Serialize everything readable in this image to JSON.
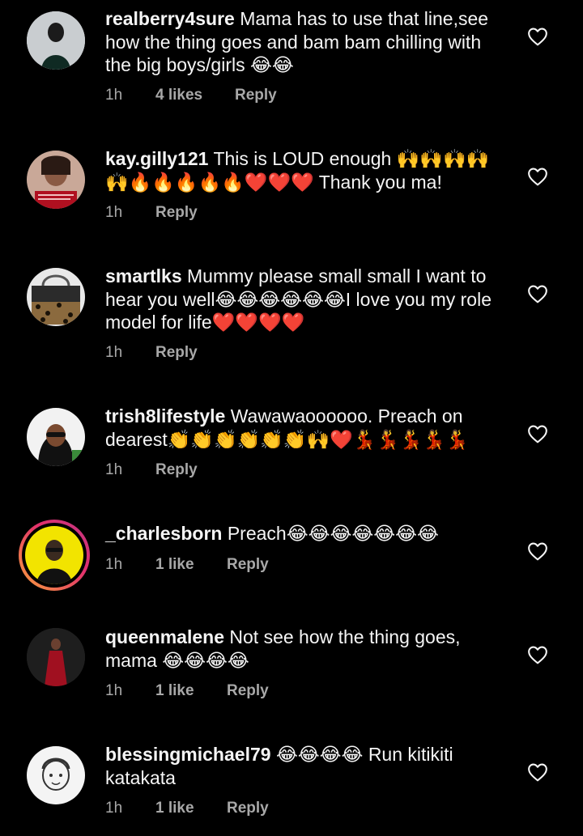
{
  "comments": [
    {
      "username": "realberry4sure",
      "text": "Mama has to use that line,see how the thing goes and bam bam chilling with the big boys/girls 😂😂",
      "time": "1h",
      "likes": "4 likes",
      "reply": "Reply"
    },
    {
      "username": "kay.gilly121",
      "text": "This is LOUD enough 🙌🙌🙌🙌🙌🔥🔥🔥🔥🔥❤️❤️❤️ Thank you ma!",
      "time": "1h",
      "reply": "Reply"
    },
    {
      "username": "smartlks",
      "text": "Mummy please small small I want to hear you well😂😂😂😂😂😂I love you my role model for life❤️❤️❤️❤️",
      "time": "1h",
      "reply": "Reply"
    },
    {
      "username": "trish8lifestyle",
      "text": "Wawawaoooooo. Preach on dearest👏👏👏👏👏👏🙌❤️💃💃💃💃💃",
      "time": "1h",
      "reply": "Reply"
    },
    {
      "username": "_charlesborn",
      "text": "Preach😂😂😂😂😂😂😂",
      "time": "1h",
      "likes": "1 like",
      "reply": "Reply"
    },
    {
      "username": "queenmalene",
      "text": "Not see how the thing goes, mama 😂😂😂😂",
      "time": "1h",
      "likes": "1 like",
      "reply": "Reply"
    },
    {
      "username": "blessingmichael79",
      "text": "😂😂😂😂 Run kitikiti katakata",
      "time": "1h",
      "likes": "1 like",
      "reply": "Reply"
    }
  ],
  "icons": {
    "like": "heart-outline-icon"
  },
  "colors": {
    "background": "#000000",
    "text": "#f5f5f5",
    "meta": "#a8a8a8",
    "story_ring": "#e1306c"
  }
}
